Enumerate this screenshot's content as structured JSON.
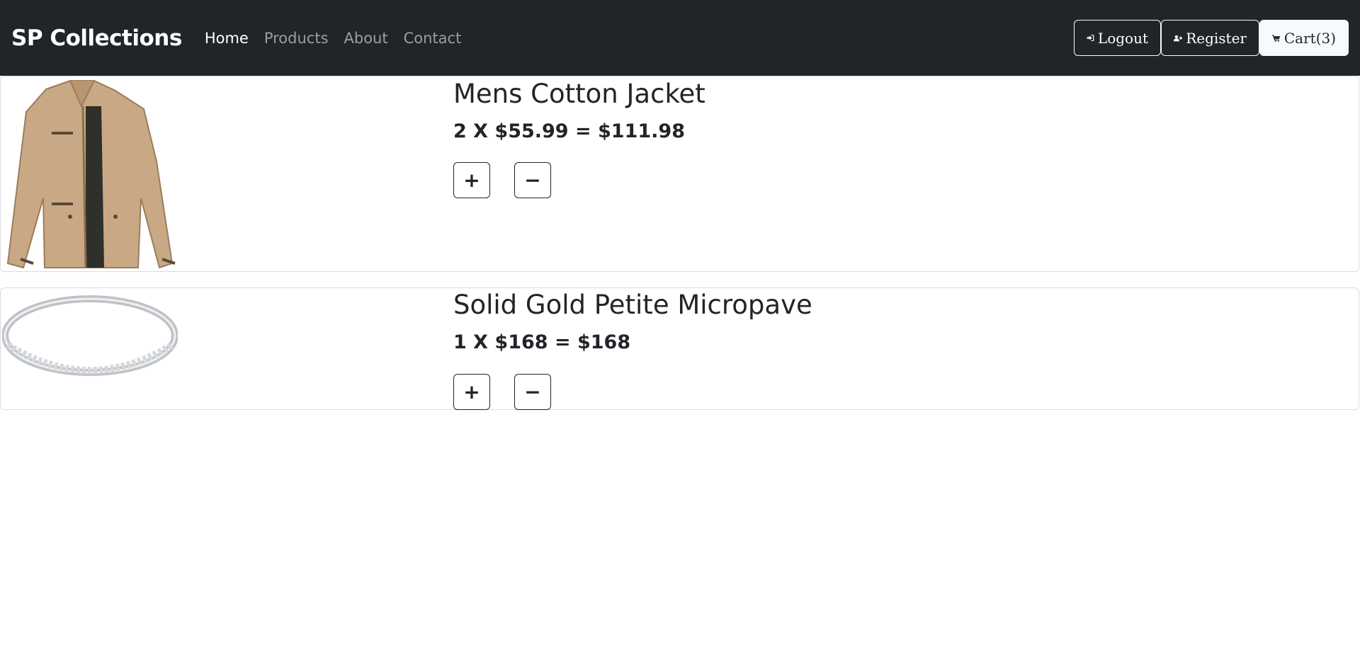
{
  "navbar": {
    "brand": "SP Collections",
    "links": [
      {
        "label": "Home",
        "active": true
      },
      {
        "label": "Products",
        "active": false
      },
      {
        "label": "About",
        "active": false
      },
      {
        "label": "Contact",
        "active": false
      }
    ],
    "actions": {
      "logout_label": "Logout",
      "register_label": "Register",
      "cart_label": "Cart(3)"
    },
    "background": "#212529"
  },
  "cart": {
    "items": [
      {
        "title": "Mens Cotton Jacket",
        "price_line": "2 X $55.99 = $111.98",
        "quantity": 2,
        "unit_price": 55.99,
        "total": 111.98,
        "image_icon": "jacket-image"
      },
      {
        "title": "Solid Gold Petite Micropave",
        "price_line": "1 X $168 = $168",
        "quantity": 1,
        "unit_price": 168,
        "total": 168,
        "image_icon": "ring-image"
      }
    ],
    "increase_label": "+",
    "decrease_label": "−"
  }
}
